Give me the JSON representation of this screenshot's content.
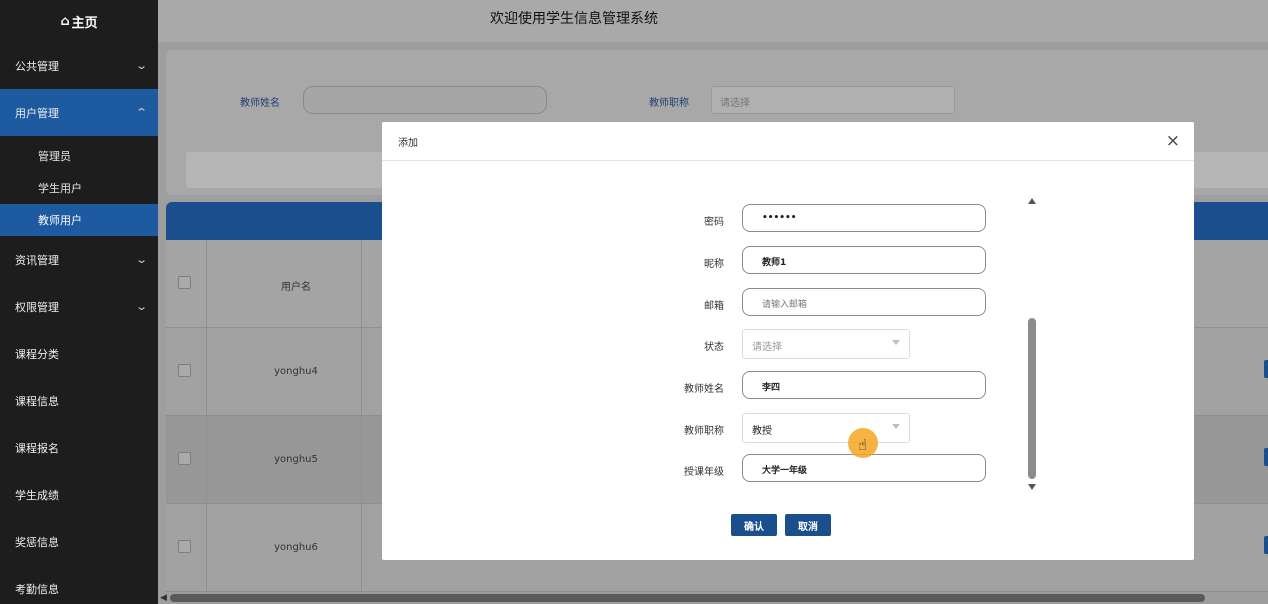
{
  "sidebar": {
    "home_icon": "home-icon",
    "home_label": "主页",
    "menus": [
      {
        "label": "公共管理",
        "chevron": "chevron-down-icon",
        "active": false
      },
      {
        "label": "用户管理",
        "chevron": "chevron-up-icon",
        "active": true
      }
    ],
    "submenu": [
      {
        "label": "管理员",
        "active": false
      },
      {
        "label": "学生用户",
        "active": false
      },
      {
        "label": "教师用户",
        "active": true
      }
    ],
    "menus_after": [
      {
        "label": "资讯管理",
        "chevron": "chevron-down-icon"
      },
      {
        "label": "权限管理",
        "chevron": "chevron-down-icon"
      },
      {
        "label": "课程分类"
      },
      {
        "label": "课程信息"
      },
      {
        "label": "课程报名"
      },
      {
        "label": "学生成绩"
      },
      {
        "label": "奖惩信息"
      },
      {
        "label": "考勤信息"
      }
    ]
  },
  "header": {
    "title": "欢迎使用学生信息管理系统"
  },
  "search": {
    "teacher_name_label": "教师姓名",
    "teacher_name_value": "",
    "teacher_title_label": "教师职称",
    "teacher_title_placeholder": "请选择"
  },
  "table": {
    "columns": [
      "用户名"
    ],
    "rows": [
      {
        "username": "yonghu4"
      },
      {
        "username": "yonghu5"
      },
      {
        "username": "yonghu6"
      }
    ]
  },
  "modal": {
    "title": "添加",
    "close_icon": "close-icon",
    "fields": {
      "password": {
        "label": "密码",
        "value": "••••••"
      },
      "nickname": {
        "label": "昵称",
        "value": "教师1"
      },
      "email": {
        "label": "邮箱",
        "placeholder": "请输入邮箱"
      },
      "status": {
        "label": "状态",
        "placeholder": "请选择"
      },
      "teacher_name": {
        "label": "教师姓名",
        "value": "李四"
      },
      "teacher_title": {
        "label": "教师职称",
        "value": "教授"
      },
      "teaching_grade": {
        "label": "授课年级",
        "value": "大学一年级"
      }
    },
    "confirm_label": "确认",
    "cancel_label": "取消"
  },
  "colors": {
    "sidebar_bg": "#1d1d1d",
    "accent": "#1e5aa0",
    "button": "#1b4e8c",
    "cursor_highlight": "#f5a623"
  }
}
